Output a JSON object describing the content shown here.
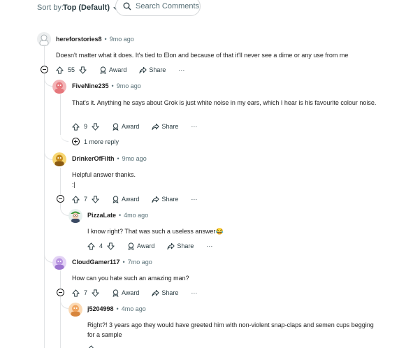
{
  "toolbar": {
    "sort_label": "Sort by:",
    "sort_value": "Top (Default)",
    "search_placeholder": "Search Comments"
  },
  "labels": {
    "award": "Award",
    "share": "Share",
    "more": "···"
  },
  "comments": [
    {
      "author": "hereforstories8",
      "age": "9mo ago",
      "text": "Doesn't matter what it does. It's tied to Elon and because of that it'll never see a dime or any use from me",
      "votes": "55",
      "avatar_color": "#d7dadc",
      "replies": [
        {
          "author": "FiveNine235",
          "age": "9mo ago",
          "text": "That's it. Anything he says about Grok is just white noise in my ears, which I hear is his favourite colour noise.",
          "votes": "9",
          "avatar_color": "#e6777c",
          "more_replies": "1 more reply"
        },
        {
          "author": "DrinkerOfFilth",
          "age": "9mo ago",
          "text_line1": "Helpful answer thanks.",
          "text_line2": ":|",
          "votes": "7",
          "avatar_color": "#e8b400",
          "replies": [
            {
              "author": "PizzaLate",
              "age": "4mo ago",
              "text": "I know right? That was such a useless answer",
              "emoji": "😂",
              "votes": "4",
              "avatar_color": "#7ec36a"
            }
          ]
        },
        {
          "author": "CloudGamer117",
          "age": "7mo ago",
          "text": "How can you hate such an amazing man?",
          "votes": "7",
          "avatar_color": "#b894e0",
          "replies": [
            {
              "author": "j5204998",
              "age": "4mo ago",
              "text": "Right?! 3 years ago they would have greeted him with non-violent snap-claps and semen cups begging for a sample",
              "votes": "",
              "avatar_color": "#f0a45e"
            }
          ]
        }
      ]
    }
  ]
}
